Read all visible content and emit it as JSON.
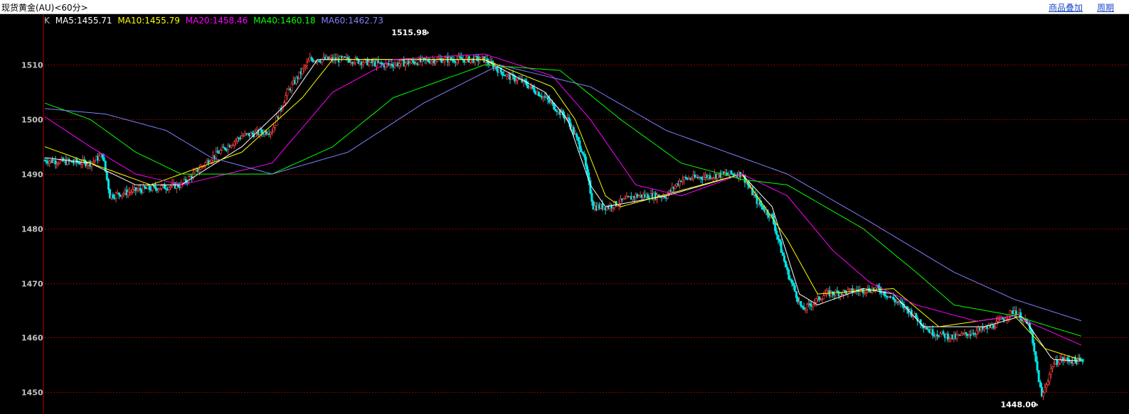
{
  "window": {
    "title": "现货黄金(AU)<60分>",
    "overlay_button": "商品叠加",
    "period_button": "周期"
  },
  "indicators": {
    "k_label": "K",
    "ma5": "MA5:1455.71",
    "ma10": "MA10:1455.79",
    "ma20": "MA20:1458.46",
    "ma40": "MA40:1460.18",
    "ma60": "MA60:1462.73"
  },
  "colors": {
    "background": "#000000",
    "up": "#ff4040",
    "down": "#00e5e5",
    "grid": "#8b0000",
    "axis_text": "#c0c0c0",
    "ma5": "#ffffff",
    "ma10": "#ffff00",
    "ma20": "#ff00ff",
    "ma40": "#00ff00",
    "ma60": "#8080ff"
  },
  "chart_data": {
    "type": "candlestick",
    "ylim": [
      1446,
      1518
    ],
    "yticks": [
      "1510",
      "1500",
      "1490",
      "1480",
      "1470",
      "1460",
      "1450"
    ],
    "max_label": "1515.98",
    "min_label": "1448.00",
    "close_anchors": [
      [
        0,
        1492.5
      ],
      [
        30,
        1492.0
      ],
      [
        38,
        1493.5
      ],
      [
        43,
        1486
      ],
      [
        60,
        1487
      ],
      [
        90,
        1488
      ],
      [
        110,
        1493
      ],
      [
        130,
        1497
      ],
      [
        150,
        1498
      ],
      [
        160,
        1505
      ],
      [
        175,
        1511
      ],
      [
        200,
        1511
      ],
      [
        225,
        1510
      ],
      [
        260,
        1511
      ],
      [
        290,
        1511
      ],
      [
        305,
        1508
      ],
      [
        315,
        1507
      ],
      [
        330,
        1504
      ],
      [
        345,
        1500
      ],
      [
        355,
        1494
      ],
      [
        362,
        1484
      ],
      [
        372,
        1484
      ],
      [
        390,
        1486
      ],
      [
        410,
        1486
      ],
      [
        420,
        1489
      ],
      [
        450,
        1490
      ],
      [
        460,
        1490
      ],
      [
        470,
        1485
      ],
      [
        480,
        1482
      ],
      [
        490,
        1472
      ],
      [
        500,
        1465
      ],
      [
        515,
        1468
      ],
      [
        550,
        1469
      ],
      [
        570,
        1465
      ],
      [
        585,
        1461
      ],
      [
        600,
        1460
      ],
      [
        625,
        1462
      ],
      [
        640,
        1465
      ],
      [
        650,
        1462
      ],
      [
        658,
        1449
      ],
      [
        665,
        1455
      ],
      [
        670,
        1456
      ],
      [
        685,
        1455.7
      ]
    ],
    "ma_anchors": {
      "MA5": [
        [
          0,
          1493
        ],
        [
          30,
          1492
        ],
        [
          60,
          1488
        ],
        [
          90,
          1488
        ],
        [
          130,
          1495
        ],
        [
          160,
          1503
        ],
        [
          180,
          1511
        ],
        [
          290,
          1511
        ],
        [
          330,
          1505
        ],
        [
          345,
          1500
        ],
        [
          360,
          1488
        ],
        [
          370,
          1484
        ],
        [
          410,
          1486
        ],
        [
          460,
          1490
        ],
        [
          480,
          1484
        ],
        [
          498,
          1468
        ],
        [
          510,
          1466
        ],
        [
          540,
          1469
        ],
        [
          560,
          1468
        ],
        [
          580,
          1462
        ],
        [
          620,
          1462
        ],
        [
          645,
          1464
        ],
        [
          655,
          1460
        ],
        [
          665,
          1456
        ],
        [
          685,
          1455.7
        ]
      ],
      "MA10": [
        [
          0,
          1495
        ],
        [
          30,
          1492
        ],
        [
          70,
          1488
        ],
        [
          130,
          1494
        ],
        [
          170,
          1504
        ],
        [
          190,
          1511
        ],
        [
          290,
          1511
        ],
        [
          335,
          1506
        ],
        [
          350,
          1500
        ],
        [
          370,
          1486
        ],
        [
          380,
          1484
        ],
        [
          420,
          1487
        ],
        [
          460,
          1490
        ],
        [
          490,
          1478
        ],
        [
          510,
          1468
        ],
        [
          560,
          1469
        ],
        [
          590,
          1462
        ],
        [
          640,
          1464
        ],
        [
          660,
          1458
        ],
        [
          685,
          1455.8
        ]
      ],
      "MA20": [
        [
          0,
          1500.5
        ],
        [
          30,
          1495
        ],
        [
          60,
          1490
        ],
        [
          90,
          1488
        ],
        [
          150,
          1492
        ],
        [
          190,
          1505
        ],
        [
          230,
          1511
        ],
        [
          290,
          1512
        ],
        [
          335,
          1508
        ],
        [
          360,
          1500
        ],
        [
          390,
          1488
        ],
        [
          420,
          1486
        ],
        [
          460,
          1490
        ],
        [
          490,
          1486
        ],
        [
          520,
          1476
        ],
        [
          545,
          1470
        ],
        [
          575,
          1466
        ],
        [
          615,
          1463
        ],
        [
          640,
          1464
        ],
        [
          685,
          1458.5
        ]
      ],
      "MA40": [
        [
          0,
          1503
        ],
        [
          30,
          1500
        ],
        [
          60,
          1494
        ],
        [
          90,
          1490
        ],
        [
          150,
          1490
        ],
        [
          190,
          1495
        ],
        [
          230,
          1504
        ],
        [
          290,
          1510
        ],
        [
          340,
          1509
        ],
        [
          380,
          1500
        ],
        [
          420,
          1492
        ],
        [
          460,
          1489
        ],
        [
          490,
          1488
        ],
        [
          540,
          1480
        ],
        [
          575,
          1472
        ],
        [
          600,
          1466
        ],
        [
          640,
          1464
        ],
        [
          685,
          1460.2
        ]
      ],
      "MA60": [
        [
          0,
          1502
        ],
        [
          40,
          1501
        ],
        [
          80,
          1498
        ],
        [
          110,
          1493
        ],
        [
          150,
          1490
        ],
        [
          200,
          1494
        ],
        [
          250,
          1503
        ],
        [
          300,
          1510
        ],
        [
          360,
          1506
        ],
        [
          410,
          1498
        ],
        [
          460,
          1493
        ],
        [
          490,
          1490
        ],
        [
          540,
          1482
        ],
        [
          600,
          1472
        ],
        [
          640,
          1467
        ],
        [
          685,
          1463
        ]
      ]
    }
  }
}
